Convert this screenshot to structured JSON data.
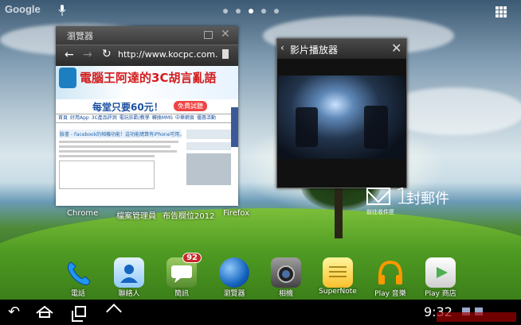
{
  "status_bar": {
    "search_label": "Google",
    "dots": 5
  },
  "browser_window": {
    "title": "瀏覽器",
    "url": "http://www.kocpc.com.",
    "site_name": "電腦王阿達的3C胡言亂語",
    "ad_text": "每堂只要60元！",
    "ad_button": "免費試聽",
    "nav_items": [
      "首頁",
      "好用App",
      "3C產品評測",
      "電玩狂歡/教學",
      "轉換MMS",
      "中華網頁",
      "優惠活動"
    ],
    "article_title": "臉書 - Facebook的相機功能！這功能總算有iPhone可用，不再死心塌地"
  },
  "video_window": {
    "title": "影片播放器"
  },
  "mail_widget": {
    "count": "1",
    "label": "封郵件",
    "sub_label": "前往收件匣"
  },
  "widget_labels": [
    "Chrome",
    "檔案管理員",
    "布告欄位2012",
    "Firefox"
  ],
  "dock": [
    {
      "label": "電話",
      "icon": "phone-icon",
      "color": "#1e88e5"
    },
    {
      "label": "聯絡人",
      "icon": "contacts-icon",
      "color": "#64b5f6"
    },
    {
      "label": "簡訊",
      "icon": "messaging-icon",
      "color": "#7cb342",
      "badge": "92"
    },
    {
      "label": "瀏覽器",
      "icon": "globe-icon",
      "color": "#1565c0"
    },
    {
      "label": "相機",
      "icon": "camera-icon",
      "color": "#555555"
    },
    {
      "label": "SuperNote",
      "icon": "notebook-icon",
      "color": "#fbc02d"
    },
    {
      "label": "Play 音樂",
      "icon": "headphones-icon",
      "color": "#ff9800"
    },
    {
      "label": "Play 商店",
      "icon": "play-store-icon",
      "color": "#eeeeee"
    }
  ],
  "navbar": {
    "clock": "9:32"
  }
}
